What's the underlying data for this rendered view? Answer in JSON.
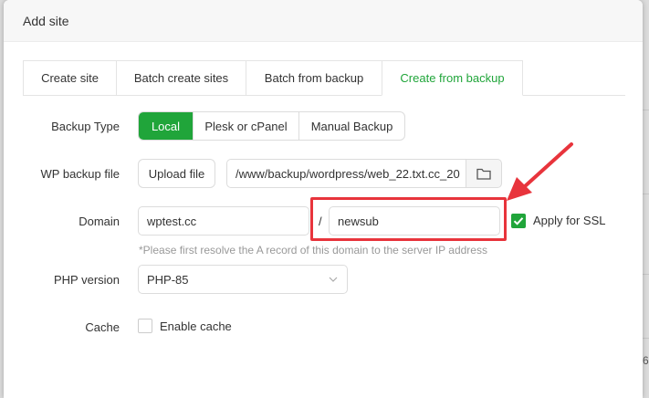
{
  "dialog": {
    "title": "Add site"
  },
  "tabs": [
    {
      "label": "Create site"
    },
    {
      "label": "Batch create sites"
    },
    {
      "label": "Batch from backup"
    },
    {
      "label": "Create from backup"
    }
  ],
  "backup_type": {
    "label": "Backup Type",
    "options": [
      "Local",
      "Plesk or cPanel",
      "Manual Backup"
    ],
    "selected": "Local"
  },
  "wp_backup": {
    "label": "WP backup file",
    "upload_label": "Upload file",
    "path_value": "/www/backup/wordpress/web_22.txt.cc_20"
  },
  "domain": {
    "label": "Domain",
    "main_value": "wptest.cc",
    "separator": "/",
    "sub_value": "newsub",
    "ssl_label": "Apply for SSL",
    "ssl_checked": true,
    "hint": "*Please first resolve the A record of this domain to the server IP address"
  },
  "php": {
    "label": "PHP version",
    "value": "PHP-85"
  },
  "cache": {
    "label": "Cache",
    "checkbox_label": "Enable cache",
    "checked": false
  },
  "colors": {
    "accent": "#20a53a",
    "annotation": "#e8343c"
  }
}
